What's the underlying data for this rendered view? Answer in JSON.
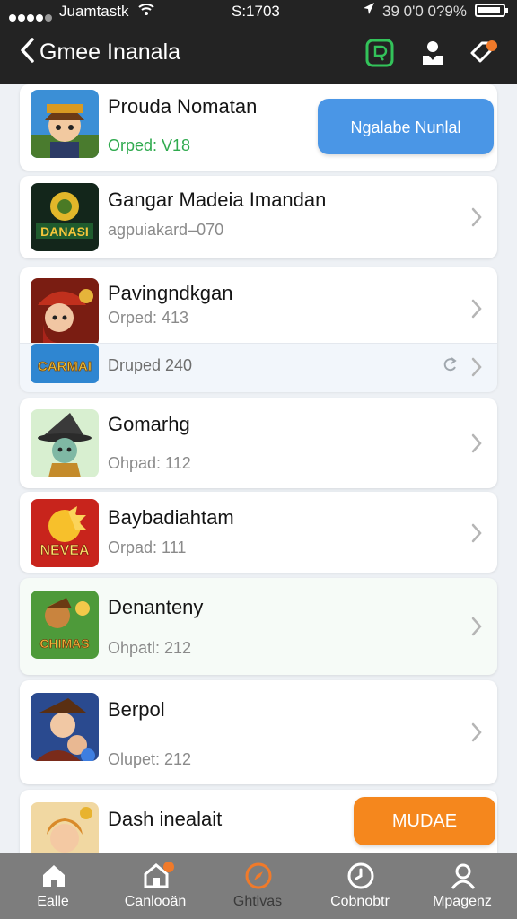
{
  "status_bar": {
    "carrier": "Juamtastk",
    "time": "S:1703",
    "right_text": "39 0'0 0?9%"
  },
  "nav": {
    "title": "Gmee Inanala"
  },
  "games": [
    {
      "name": "Prouda Nomatan",
      "subtitle": "Orped: V18",
      "action": "Ngalabe Nunlal"
    },
    {
      "name": "Gangar Madeia Imandan",
      "subtitle": "agpuiakard–070"
    },
    {
      "name": "Pavingndkgan",
      "subtitle": "Orped: 413"
    },
    {
      "name": "",
      "subtitle": "Druped 240"
    },
    {
      "name": "Gomarhg",
      "subtitle": "Ohpad: 112"
    },
    {
      "name": "Baybadiahtam",
      "subtitle": "Orpad: 111"
    },
    {
      "name": "Denanteny",
      "subtitle": "Ohpatl: 212"
    },
    {
      "name": "Berpol",
      "subtitle": "Olupet: 212"
    },
    {
      "name": "Dash inealait",
      "subtitle": "",
      "action": "MUDAE"
    }
  ],
  "icon_texts": {
    "g2": "DANASI",
    "g4": "CARMAI",
    "g6": "NEVEA",
    "g7": "CHIMAS"
  },
  "tabs": [
    {
      "label": "Ealle",
      "icon": "home-icon"
    },
    {
      "label": "Canlooän",
      "icon": "shop-icon"
    },
    {
      "label": "Ghtivas",
      "icon": "compass-icon"
    },
    {
      "label": "Cobnobtr",
      "icon": "clock-icon"
    },
    {
      "label": "Mpagenz",
      "icon": "person-icon"
    }
  ],
  "colors": {
    "header": "#232323",
    "blue_button": "#4a96e6",
    "orange_button": "#f5871d",
    "green_text": "#2faa4e",
    "tabbar": "#7d7d7d",
    "accent_active": "#f07a2a"
  }
}
